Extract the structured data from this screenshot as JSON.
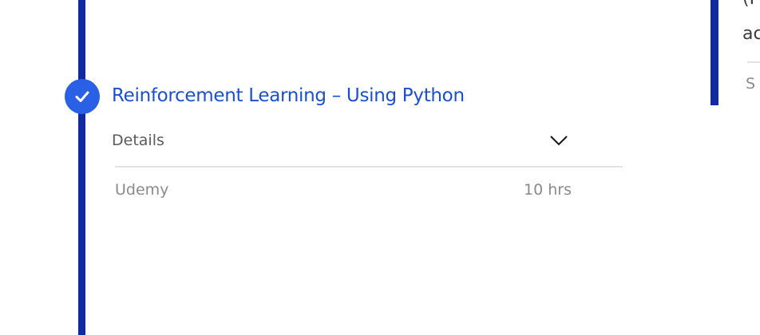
{
  "course": {
    "title": "Reinforcement Learning – Using Python",
    "completed": true,
    "details_label": "Details",
    "provider": "Udemy",
    "duration": "10 hrs"
  },
  "icons": {
    "status": "check-icon",
    "expand": "chevron-down-icon"
  },
  "adjacent_card": {
    "line1": "(I",
    "line2": "ac",
    "line3": "S"
  },
  "colors": {
    "rail": "#1129a3",
    "badge": "#2a60e6",
    "title": "#1a4fd3"
  }
}
